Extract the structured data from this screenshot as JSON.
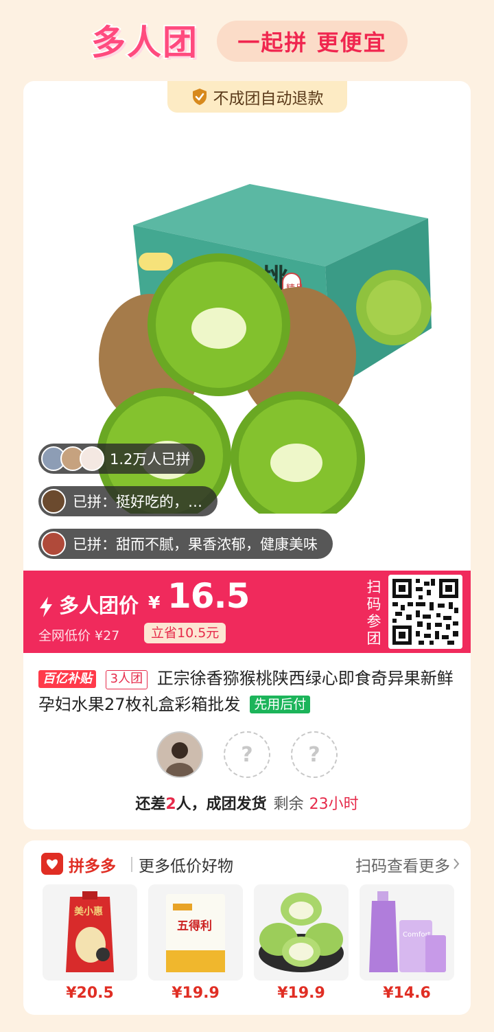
{
  "header": {
    "brand": "多人团",
    "slogan": "一起拼 更便宜"
  },
  "card": {
    "refund_badge": "不成团自动退款",
    "social": {
      "count_text": "1.2万人已拼",
      "reviews": [
        "已拼：挺好吃的，…",
        "已拼：甜而不腻，果香浓郁，健康美味"
      ]
    },
    "price": {
      "label": "多人团价",
      "currency": "¥",
      "value": "16.5",
      "original": "全网低价 ¥27",
      "save": "立省10.5元",
      "scan_label": "扫码参团"
    },
    "product": {
      "subsidy_tag": "百亿补贴",
      "group_tag": "3人团",
      "title": "正宗徐香猕猴桃陕西绿心即食奇异果新鲜孕妇水果27枚礼盒彩箱批发",
      "pay_tag": "先用后付",
      "box_text": "猕猴桃",
      "box_small": "精品"
    },
    "group": {
      "empty_slot": "?",
      "need_prefix": "还差",
      "need_count": "2",
      "need_suffix": "人，成团发货",
      "remain_label": "剩余",
      "remain_time": "23小时"
    }
  },
  "recommend": {
    "app_name": "拼多多",
    "subtitle": "更多低价好物",
    "more": "扫码查看更多",
    "items": [
      {
        "name": "rice",
        "price": "¥20.5",
        "pkg_text": "美小惠"
      },
      {
        "name": "flour",
        "price": "¥19.9",
        "pkg_text": "五得利"
      },
      {
        "name": "guava",
        "price": "¥19.9"
      },
      {
        "name": "softener",
        "price": "¥14.6",
        "pkg_text": "Comfort"
      }
    ]
  },
  "colors": {
    "accent": "#f02a5c",
    "brand_red": "#e02e24",
    "background": "#fdf1e2",
    "badge_bg": "#fdebc4",
    "pay_green": "#1cb45a"
  }
}
